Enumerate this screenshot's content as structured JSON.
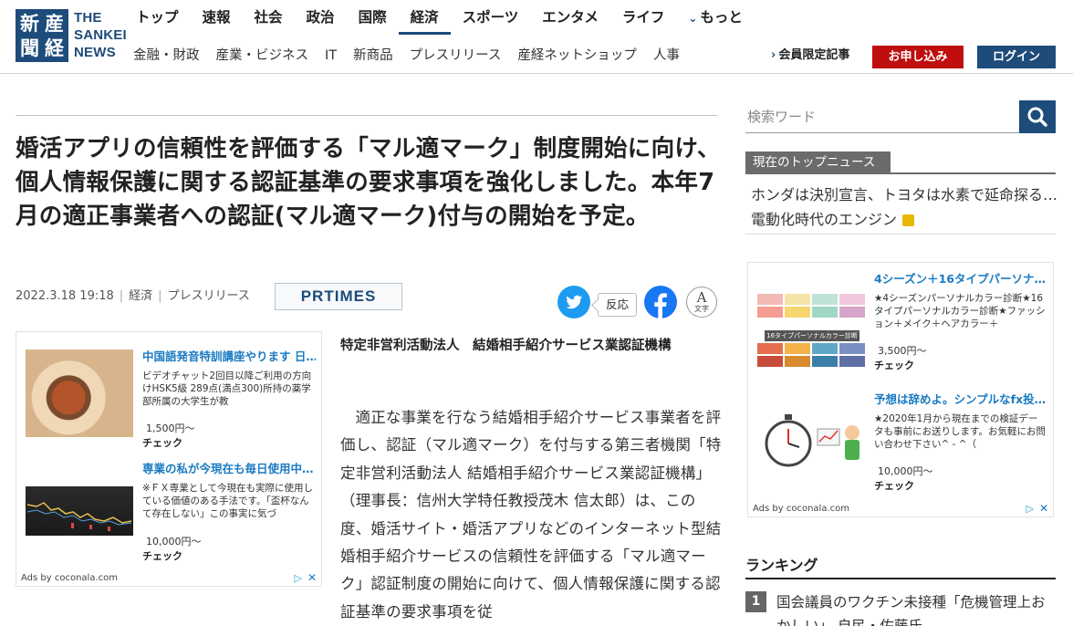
{
  "header": {
    "logo_kanji": [
      "新",
      "産",
      "聞",
      "経"
    ],
    "logo_text": [
      "THE",
      "SANKEI",
      "NEWS"
    ],
    "nav_main": [
      {
        "label": "トップ"
      },
      {
        "label": "速報"
      },
      {
        "label": "社会"
      },
      {
        "label": "政治"
      },
      {
        "label": "国際"
      },
      {
        "label": "経済"
      },
      {
        "label": "スポーツ"
      },
      {
        "label": "エンタメ"
      },
      {
        "label": "ライフ"
      }
    ],
    "nav_more": "もっと",
    "nav_sub": [
      {
        "label": "金融・財政"
      },
      {
        "label": "産業・ビジネス"
      },
      {
        "label": "IT"
      },
      {
        "label": "新商品"
      },
      {
        "label": "プレスリリース"
      },
      {
        "label": "産経ネットショップ"
      },
      {
        "label": "人事"
      }
    ],
    "member_link": "会員限定記事",
    "apply_label": "お申し込み",
    "login_label": "ログイン",
    "colors": {
      "brand": "#1d4b7a",
      "apply": "#c00d0d"
    }
  },
  "article": {
    "headline": "婚活アプリの信頼性を評価する「マル適マーク」制度開始に向け、個人情報保護に関する認証基準の要求事項を強化しました。本年7月の適正事業者への認証(マル適マーク)付与の開始を予定。",
    "date": "2022.3.18 19:18",
    "category_1": "経済",
    "category_2": "プレスリリース",
    "source": "PRTIMES",
    "reaction_label": "反応",
    "font_label_a": "A",
    "font_label_text": "文字",
    "issuer": "特定非営利活動法人　結婚相手紹介サービス業認証機構",
    "body": "適正な事業を行なう結婚相手紹介サービス事業者を評価し、認証（マル適マーク）を付与する第三者機関「特定非営利活動法人 結婚相手紹介サービス業認証機構」（理事長：信州大学特任教授茂木 信太郎）は、この度、婚活サイト・婚活アプリなどのインターネット型結婚相手紹介サービスの信頼性を評価する「マル適マーク」認証制度の開始に向けて、個人情報保護に関する認証基準の要求事項を従"
  },
  "ad_left": {
    "items": [
      {
        "title": "中国語発音特訓講座やります 日…",
        "desc": "ビデオチャット2回目以降ご利用の方向けHSK5級 289点(満点300)所持の薬学部所属の大学生が教",
        "price": "1,500円〜",
        "check": "チェック"
      },
      {
        "title": "専業の私が今現在も毎日使用中…",
        "desc": "※ＦＸ専業として今現在も実際に使用している価値のある手法です。「盃杯なんて存在しない」この事実に気づ",
        "price": "10,000円〜",
        "check": "チェック"
      }
    ],
    "ads_by": "Ads by coconala.com"
  },
  "sidebar": {
    "search_placeholder": "検索ワード",
    "top_news_label": "現在のトップニュース",
    "top_news_text": "ホンダは決別宣言、トヨタは水素で延命探る…電動化時代のエンジン",
    "ad_right": {
      "items": [
        {
          "title": "4シーズン＋16タイプパーソナ…",
          "desc": "★4シーズンパーソナルカラー診断★16タイプパーソナルカラー診断★ファッション＋メイク＋ヘアカラー＋",
          "price": "3,500円〜",
          "check": "チェック",
          "img_caption": "16タイプパーソナルカラー診断"
        },
        {
          "title": "予想は辞めよ。シンプルなfx投…",
          "desc": "★2020年1月から現在までの検証データも事前にお送りします。お気軽にお問い合わせ下さい^ - ^（",
          "price": "10,000円〜",
          "check": "チェック"
        }
      ],
      "ads_by": "Ads by coconala.com"
    },
    "ranking_title": "ランキング",
    "ranking_items": [
      {
        "rank": "1",
        "text": "国会議員のワクチン未接種「危機管理上おかしい」 自民・佐藤氏"
      }
    ]
  }
}
